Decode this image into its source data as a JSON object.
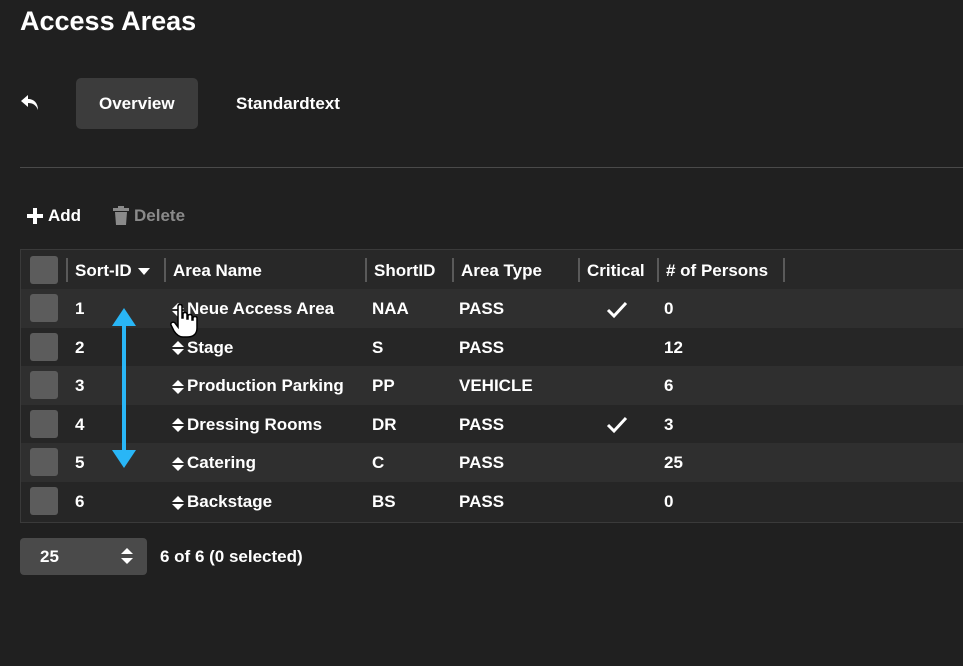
{
  "page": {
    "title": "Access Areas"
  },
  "tabs": [
    {
      "label": "Overview",
      "active": true
    },
    {
      "label": "Standardtext",
      "active": false
    }
  ],
  "toolbar": {
    "add_label": "Add",
    "delete_label": "Delete"
  },
  "icons": {
    "back": "undo-arrow-icon",
    "add": "plus-icon",
    "delete": "trash-icon",
    "sort": "caret-down-icon",
    "drag": "drag-sort-icon",
    "check": "checkmark-icon",
    "cursor": "hand-cursor-icon",
    "drag_indicator": "vertical-double-arrow-icon"
  },
  "colors": {
    "accent_arrow": "#29b6f6",
    "background": "#202020"
  },
  "table": {
    "columns": [
      "Sort-ID",
      "Area Name",
      "ShortID",
      "Area Type",
      "Critical",
      "# of Persons"
    ],
    "rows": [
      {
        "sort_id": "1",
        "name": "Neue Access Area",
        "short_id": "NAA",
        "type": "PASS",
        "critical": true,
        "persons": "0"
      },
      {
        "sort_id": "2",
        "name": "Stage",
        "short_id": "S",
        "type": "PASS",
        "critical": false,
        "persons": "12"
      },
      {
        "sort_id": "3",
        "name": "Production Parking",
        "short_id": "PP",
        "type": "VEHICLE",
        "critical": false,
        "persons": "6"
      },
      {
        "sort_id": "4",
        "name": "Dressing Rooms",
        "short_id": "DR",
        "type": "PASS",
        "critical": true,
        "persons": "3"
      },
      {
        "sort_id": "5",
        "name": "Catering",
        "short_id": "C",
        "type": "PASS",
        "critical": false,
        "persons": "25"
      },
      {
        "sort_id": "6",
        "name": "Backstage",
        "short_id": "BS",
        "type": "PASS",
        "critical": false,
        "persons": "0"
      }
    ]
  },
  "pager": {
    "page_size": "25",
    "status": "6 of 6 (0 selected)"
  }
}
